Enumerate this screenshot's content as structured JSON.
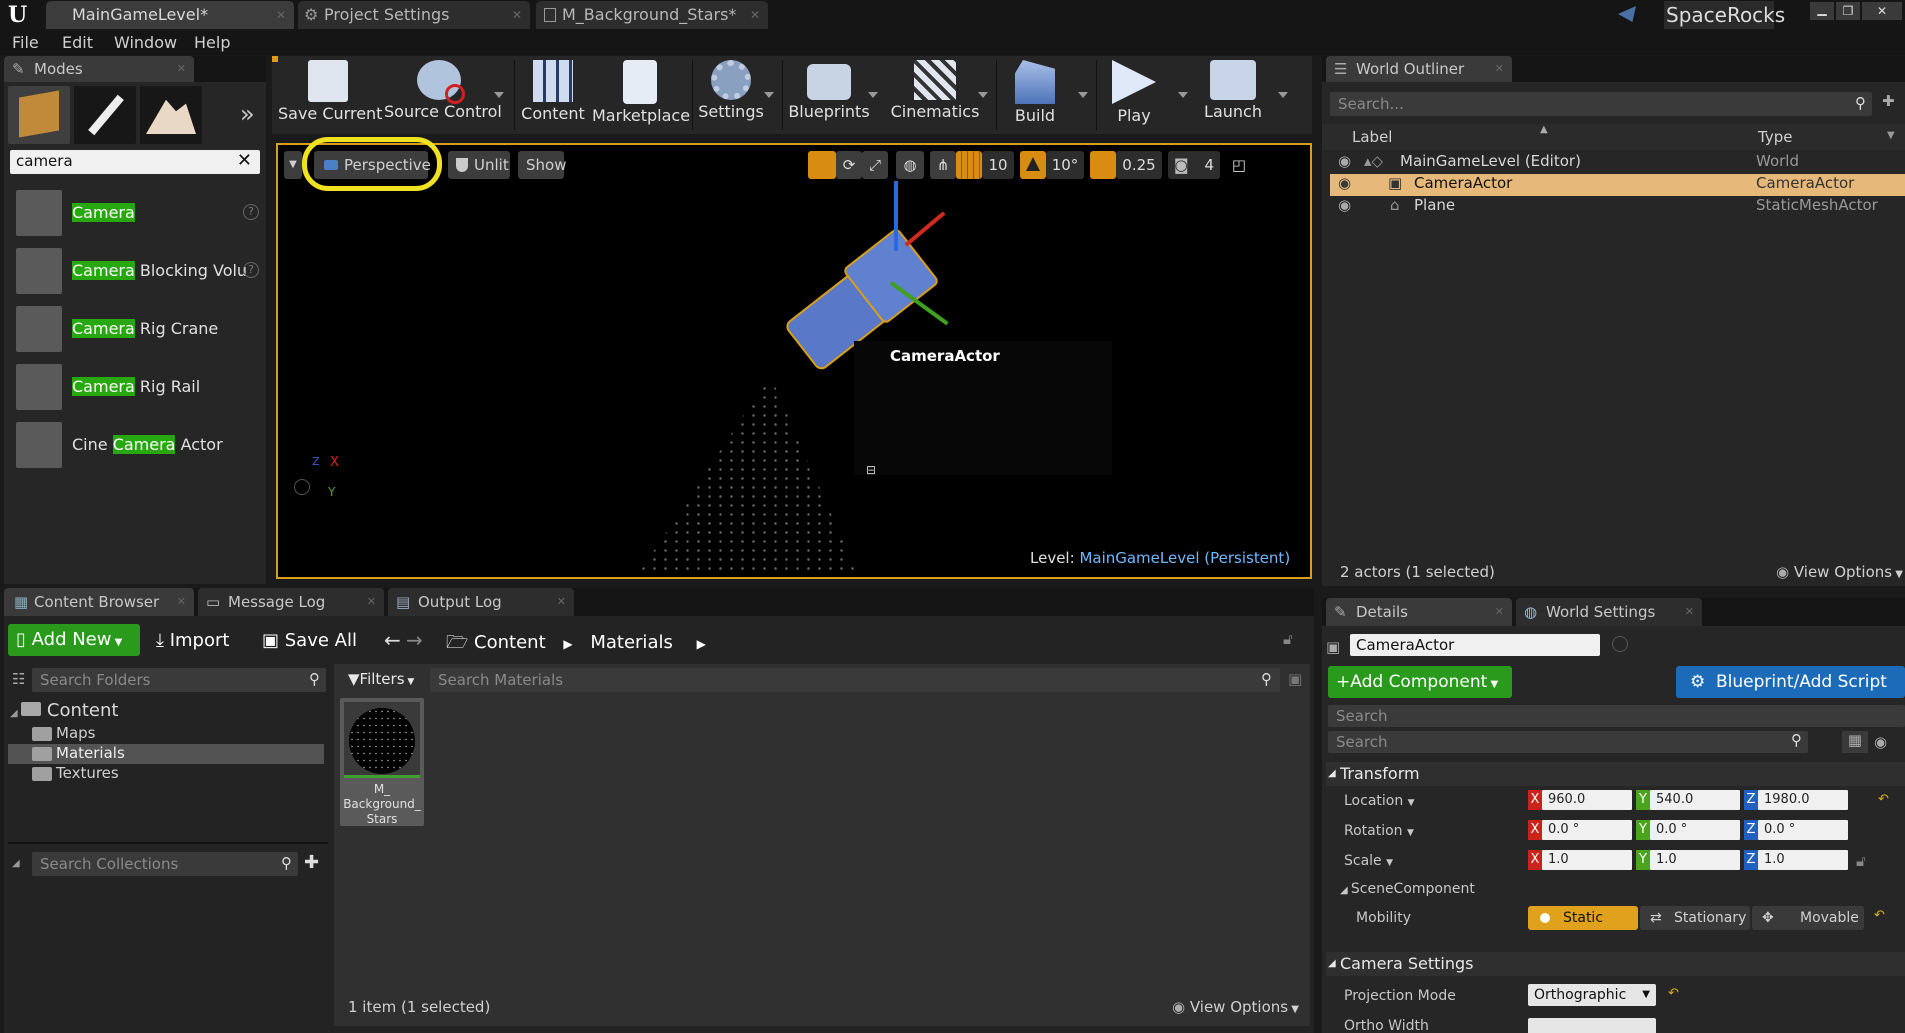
{
  "titlebar": {
    "tabs": [
      "MainGameLevel*",
      "Project Settings",
      "M_Background_Stars*"
    ],
    "project_name": "SpaceRocks"
  },
  "menu": [
    "File",
    "Edit",
    "Window",
    "Help"
  ],
  "modes": {
    "tab": "Modes",
    "search_value": "camera",
    "highlight": "Camera",
    "items": [
      {
        "pre": "",
        "hl": "Camera",
        "post": ""
      },
      {
        "pre": "",
        "hl": "Camera",
        "post": " Blocking Volu"
      },
      {
        "pre": "",
        "hl": "Camera",
        "post": " Rig Crane"
      },
      {
        "pre": "",
        "hl": "Camera",
        "post": " Rig Rail"
      },
      {
        "pre": "Cine ",
        "hl": "Camera",
        "post": " Actor"
      }
    ]
  },
  "toolbar": [
    "Save Current",
    "Source Control",
    "Content",
    "Marketplace",
    "Settings",
    "Blueprints",
    "Cinematics",
    "Build",
    "Play",
    "Launch"
  ],
  "viewport": {
    "perspective": "Perspective",
    "unlit": "Unlit",
    "show": "Show",
    "grid_snap": "10",
    "rot_snap": "10°",
    "scale_snap": "0.25",
    "cam_speed": "4",
    "actor_label": "CameraActor",
    "level_prefix": "Level:",
    "level_name": "MainGameLevel (Persistent)",
    "axis_x": "X",
    "axis_y": "Y",
    "axis_z": "Z"
  },
  "outliner": {
    "tab": "World Outliner",
    "search_placeholder": "Search...",
    "col_label": "Label",
    "col_type": "Type",
    "rows": [
      {
        "label": "MainGameLevel (Editor)",
        "type": "World"
      },
      {
        "label": "CameraActor",
        "type": "CameraActor"
      },
      {
        "label": "Plane",
        "type": "StaticMeshActor"
      }
    ],
    "status": "2 actors (1 selected)",
    "view_options": "View Options"
  },
  "bottom_tabs": [
    "Content Browser",
    "Message Log",
    "Output Log"
  ],
  "content_browser": {
    "add_new": "Add New",
    "import": "Import",
    "save_all": "Save All",
    "path": [
      "Content",
      "Materials"
    ],
    "search_folders": "Search Folders",
    "filters": "Filters",
    "search_materials": "Search Materials",
    "tree_root": "Content",
    "folders": [
      "Maps",
      "Materials",
      "Textures"
    ],
    "search_collections": "Search Collections",
    "asset_name": "M_Background_Stars",
    "asset_lines": [
      "M_",
      "Background_",
      "Stars"
    ],
    "status": "1 item (1 selected)",
    "view_options": "View Options"
  },
  "details": {
    "tabs": [
      "Details",
      "World Settings"
    ],
    "actor_name": "CameraActor",
    "add_component": "Add Component",
    "blueprint": "Blueprint/Add Script",
    "search1": "Search",
    "search2": "Search",
    "transform": "Transform",
    "location_label": "Location",
    "location": [
      "960.0",
      "540.0",
      "1980.0"
    ],
    "rotation_label": "Rotation",
    "rotation": [
      "0.0 °",
      "0.0 °",
      "0.0 °"
    ],
    "scale_label": "Scale",
    "scale": [
      "1.0",
      "1.0",
      "1.0"
    ],
    "scene_component": "SceneComponent",
    "mobility_label": "Mobility",
    "mobility": [
      "Static",
      "Stationary",
      "Movable"
    ],
    "camera_settings": "Camera Settings",
    "projection_label": "Projection Mode",
    "projection_value": "Orthographic",
    "ortho_width_label": "Ortho Width"
  },
  "colors": {
    "accent_orange": "#d99f1a",
    "highlight_green": "#27a80e",
    "selection": "#e6b97a",
    "blue_button": "#1c6bb8"
  }
}
